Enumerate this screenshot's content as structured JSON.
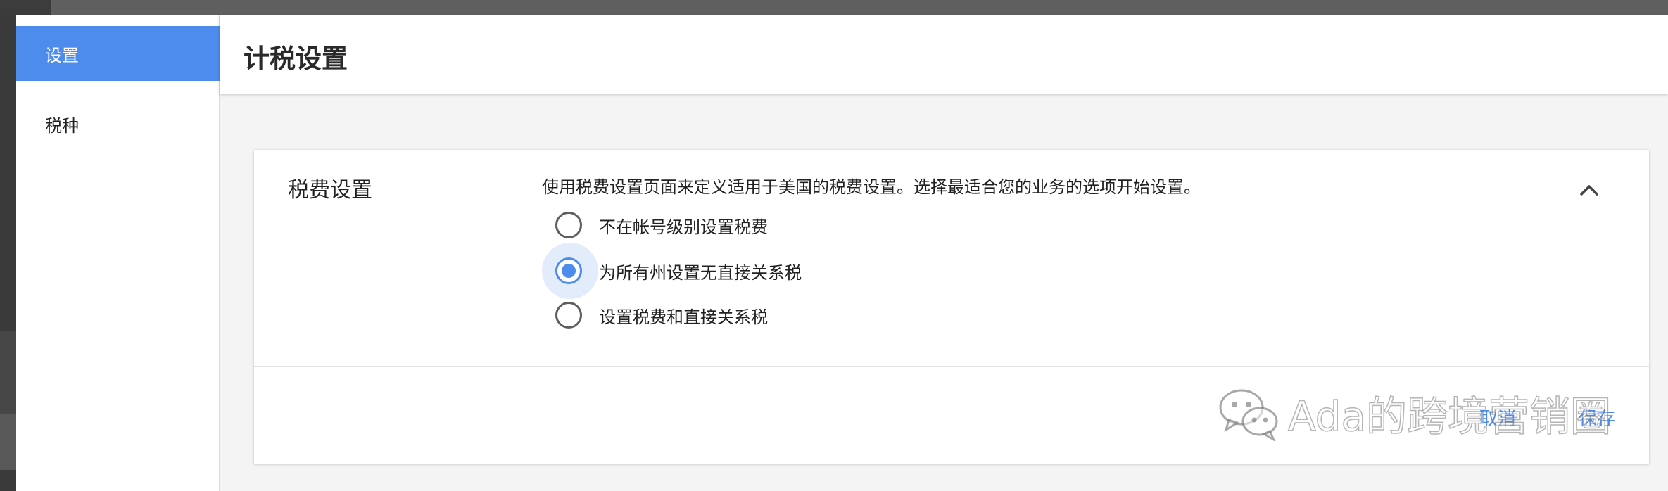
{
  "sidebar": {
    "items": [
      {
        "label": "设置",
        "active": true
      },
      {
        "label": "税种",
        "active": false
      }
    ]
  },
  "header": {
    "title": "计税设置"
  },
  "card": {
    "heading": "税费设置",
    "description": "使用税费设置页面来定义适用于美国的税费设置。选择最适合您的业务的选项开始设置。",
    "options": [
      {
        "label": "不在帐号级别设置税费",
        "selected": false
      },
      {
        "label": "为所有州设置无直接关系税",
        "selected": true
      },
      {
        "label": "设置税费和直接关系税",
        "selected": false
      }
    ],
    "footer": {
      "cancel_label": "取消",
      "save_label": "保存"
    }
  },
  "watermark": {
    "text": "Ada的跨境营销圈",
    "icon": "wechat-icon"
  },
  "colors": {
    "accent": "#4d8bed",
    "background": "#f4f4f4",
    "topbar": "#5f5f5f"
  }
}
